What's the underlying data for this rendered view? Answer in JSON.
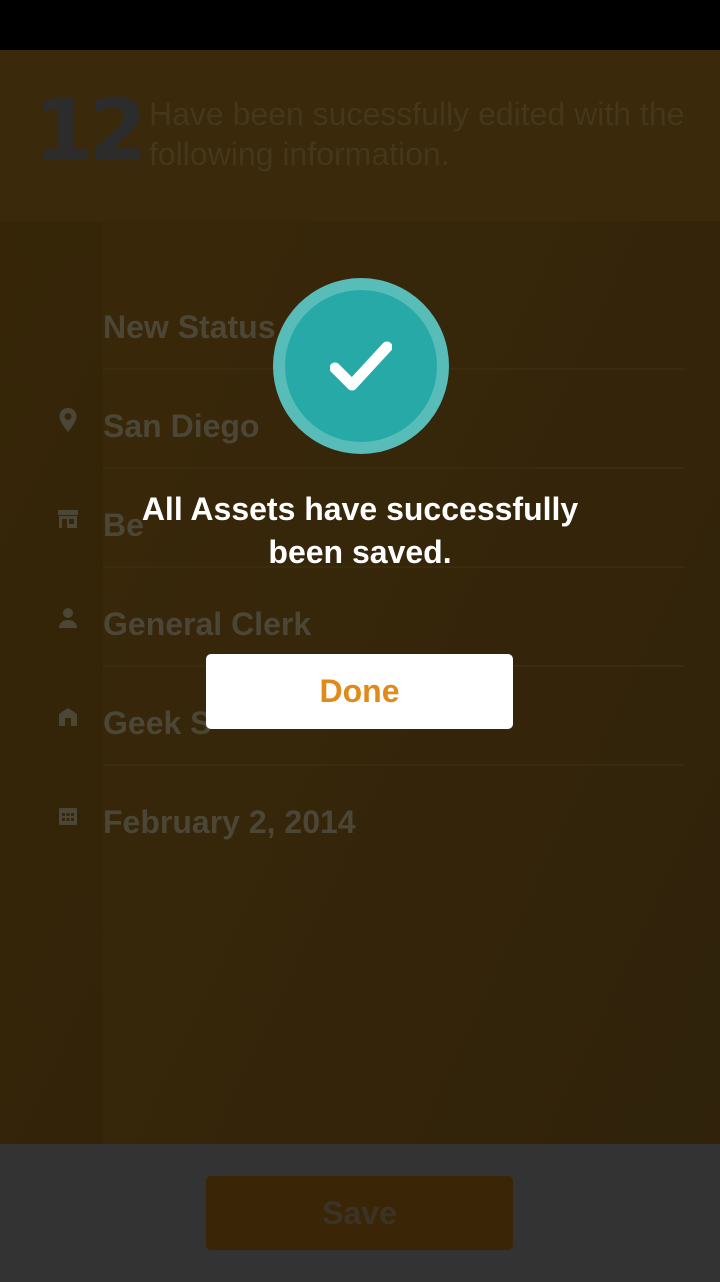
{
  "summary": {
    "count": "12",
    "description": "Have been sucessfully edited with the following information."
  },
  "fields": [
    {
      "icon": "status-icon",
      "label": "New Status"
    },
    {
      "icon": "location-pin-icon",
      "label": "San Diego"
    },
    {
      "icon": "storefront-icon",
      "label": "Be"
    },
    {
      "icon": "person-icon",
      "label": "General Clerk"
    },
    {
      "icon": "building-icon",
      "label": "Geek S"
    },
    {
      "icon": "calendar-icon",
      "label": "February 2, 2014"
    }
  ],
  "footer": {
    "save_label": "Save"
  },
  "dialog": {
    "icon": "checkmark-icon",
    "message": "All Assets have successfully been saved.",
    "done_label": "Done"
  },
  "colors": {
    "accent": "#e08a1a",
    "success": "#27aaa7",
    "success_ring": "#58bdb8"
  }
}
